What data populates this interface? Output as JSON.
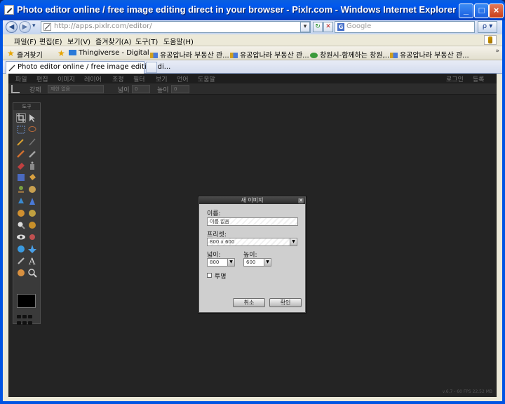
{
  "window": {
    "title": "Photo editor online / free image editing direct in your browser - Pixlr.com - Windows Internet Explorer",
    "controls": [
      "_",
      "□",
      "×"
    ]
  },
  "address_bar": {
    "url": "http://apps.pixlr.com/editor/",
    "search_placeholder": "Google",
    "search_icon_letter": "G",
    "back_glyph": "◀",
    "forward_glyph": "▶",
    "dropdown_glyph": "▾",
    "refresh_glyph": "↻",
    "stop_glyph": "✕",
    "search_button": "ρ ▾"
  },
  "menu": [
    "파일(F)",
    "편집(E)",
    "보기(V)",
    "즐겨찾기(A)",
    "도구(T)",
    "도움말(H)"
  ],
  "favorites_bar": {
    "label": "즐겨찾기",
    "star_glyph": "★",
    "chevron_glyph": "»",
    "items": [
      {
        "label": "Thingiverse - Digital ...",
        "icon_color": "#2a7ad8"
      },
      {
        "label": "유공압나라  부동산 관...",
        "icon_color": "#4a7ad8"
      },
      {
        "label": "유공압나라  부동산 관...",
        "icon_color": "#4a7ad8"
      },
      {
        "label": "창원시-함께하는 창원,...",
        "icon_color": "#3a9a3a"
      },
      {
        "label": "유공압나라  부동산 관...",
        "icon_color": "#4a7ad8"
      }
    ]
  },
  "tab": {
    "label": "Photo editor online / free image editing di..."
  },
  "pixlr": {
    "menu": [
      "파일",
      "편집",
      "이미지",
      "레이어",
      "조정",
      "필터",
      "보기",
      "언어",
      "도움말"
    ],
    "menu_right": [
      "로그인",
      "등록"
    ],
    "options": {
      "constraint_label": "강제",
      "constraint_value": "제한 없음",
      "width_label": "넓이",
      "width_value": "0",
      "height_label": "높이",
      "height_value": "0"
    },
    "tools_title": "도구",
    "status": "v.6.7 - 60 FPS 22.52 MB"
  },
  "dialog": {
    "title": "새 이미지",
    "close_glyph": "✕",
    "name_label": "이름:",
    "name_value": "이름 없음",
    "preset_label": "프리셋:",
    "preset_value": "800 x 600",
    "width_label": "넓이:",
    "width_value": "800",
    "height_label": "높이:",
    "height_value": "600",
    "transparent_label": "투명",
    "transparent_checked": false,
    "arrow_glyph": "▼",
    "cancel_label": "취소",
    "ok_label": "확인"
  }
}
